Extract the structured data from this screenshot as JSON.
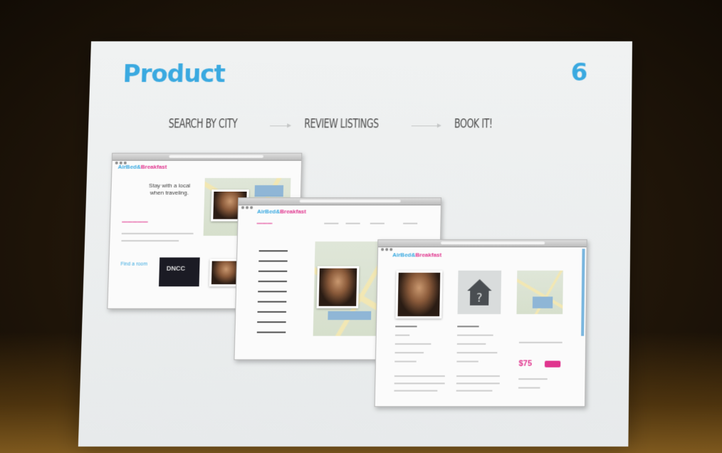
{
  "slide": {
    "title": "Product",
    "number": "6",
    "steps": [
      "SEARCH BY CITY",
      "REVIEW LISTINGS",
      "BOOK IT!"
    ]
  },
  "screens": {
    "brand_part1": "AirBed&",
    "brand_part2": "Breakfast",
    "search": {
      "tagline_line1": "Stay with a local",
      "tagline_line2": "when traveling.",
      "event_tile": "DNCC",
      "side_label": "Find a room"
    },
    "listing": {
      "price": "$75",
      "house_icon": "question-house-icon"
    }
  },
  "colors": {
    "accent_blue": "#3aa9e0",
    "accent_pink": "#e0358e",
    "step_text": "#4e4e4e"
  }
}
